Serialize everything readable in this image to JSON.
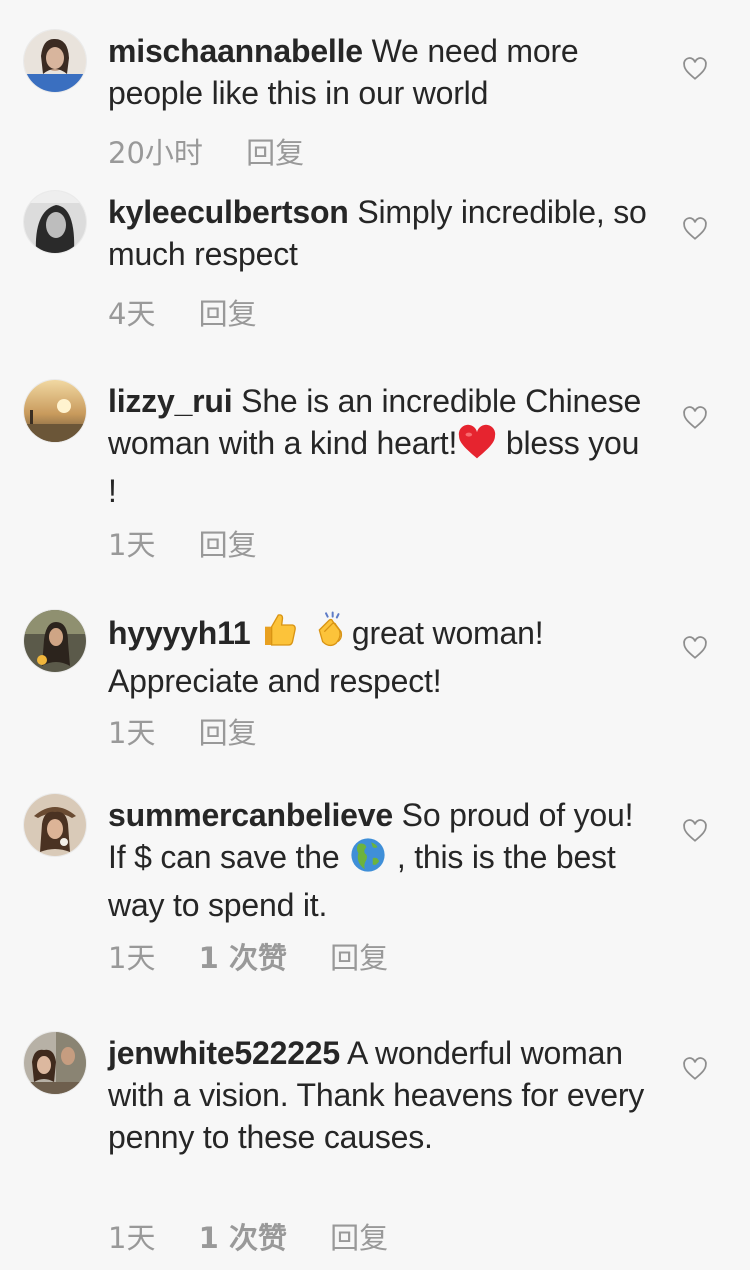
{
  "comments": [
    {
      "user": "mischaannabelle",
      "text": "We need more people like this in our world",
      "time": "20小时",
      "likes": "",
      "reply": "回复"
    },
    {
      "user": "kyleeculbertson",
      "text": "Simply incredible, so much respect",
      "time": "4天",
      "likes": "",
      "reply": "回复"
    },
    {
      "user": "lizzy_rui",
      "text_a": "She is an incredible Chinese woman with a kind heart!",
      "text_b": " bless you !",
      "time": "1天",
      "likes": "",
      "reply": "回复"
    },
    {
      "user": "hyyyyh11",
      "text_b": "great woman! Appreciate and respect!",
      "time": "1天",
      "likes": "",
      "reply": "回复"
    },
    {
      "user": "summercanbelieve",
      "text_a": "So proud of you! If $ can save the",
      "text_b": " , this is the best way to spend it.",
      "time": "1天",
      "likes": "1 次赞",
      "reply": "回复"
    },
    {
      "user": "jenwhite522225",
      "text": "A wonderful woman with a vision. Thank heavens for every penny to these causes.",
      "time": "1天",
      "likes": "1 次赞",
      "reply": "回复"
    }
  ],
  "icons": {
    "heart": "heart-outline-icon",
    "red_heart": "red-heart-emoji",
    "thumbs_up": "thumbs-up-emoji",
    "clap": "clapping-hands-emoji",
    "globe": "globe-americas-emoji"
  }
}
